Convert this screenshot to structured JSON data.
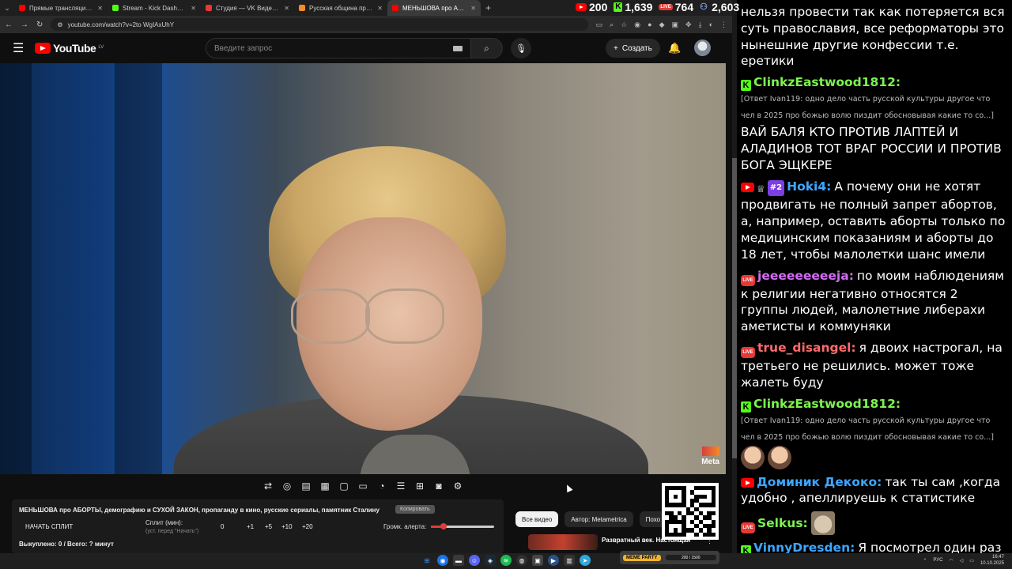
{
  "browser": {
    "tabs": [
      {
        "title": "Прямые трансляции - YouTube",
        "color": "#ff0000",
        "active": false
      },
      {
        "title": "Stream - Kick Dashboard",
        "color": "#53fc18",
        "active": false
      },
      {
        "title": "Студия — VK Видео Live",
        "color": "#e53935",
        "active": false
      },
      {
        "title": "Русская община про мигрант...",
        "color": "#f28c28",
        "active": false
      },
      {
        "title": "МЕНЬШОВА про АБОРТЫ...",
        "color": "#ff0000",
        "active": true
      }
    ],
    "url": "youtube.com/watch?v=2to WgIAxUhY"
  },
  "counters": {
    "youtube": "200",
    "kick": "1,639",
    "vk": "764",
    "total": "2,603"
  },
  "youtube": {
    "logo_text": "YouTube",
    "logo_region": "LV",
    "search_placeholder": "Введите запрос",
    "create_label": "Создать",
    "video_watermark": "Meta"
  },
  "split_panel": {
    "title": "МЕНЬШОВА про АБОРТЫ, демографию и СУХОЙ ЗАКОН, пропаганду в кино, русские сериалы, памятник Сталину",
    "copy_label": "Копировать",
    "start_label": "НАЧАТЬ СПЛИТ",
    "split_min_label": "Сплит (мин):",
    "split_min_hint": "(уст. перед \"Начать\")",
    "split_value": "0",
    "increments": [
      "+1",
      "+5",
      "+10",
      "+20"
    ],
    "alert_volume_label": "Громк. алерта:",
    "alert_volume": 0.2,
    "bought_label": "Выкуплено: 0 / Всего: ? минут"
  },
  "recommendations": {
    "chips": [
      {
        "label": "Все видео",
        "active": true
      },
      {
        "label": "Автор: Metametrica",
        "active": false
      },
      {
        "label": "Похо",
        "active": false
      }
    ],
    "first_video_title": "Развратный век. Настоящая"
  },
  "chat": {
    "messages": [
      {
        "badges": [],
        "user": "",
        "user_color": "#ffffff",
        "reply": "",
        "text": "нельзя провести так как потеряется вся суть православия, все реформаторы это нынешние другие конфессии т.е. еретики"
      },
      {
        "badges": [
          "kick"
        ],
        "user": "ClinkzEastwood1812:",
        "user_color": "#7cf34f",
        "reply": "[Ответ Ivan119: одно дело часть русской культуры другое что чел в 2025 про божью волю пиздит обосновывая какие то со...]",
        "text": "ВАЙ БАЛЯ КТО ПРОТИВ ЛАПТЕЙ И АЛАДИНОВ ТОТ ВРАГ РОССИИ И ПРОТИВ БОГА ЭЩКЕРЕ"
      },
      {
        "badges": [
          "youtube",
          "crown",
          "rank"
        ],
        "rank": "#2",
        "user": "Hoki4:",
        "user_color": "#3ea6ff",
        "reply": "",
        "text": "А почему они не хотят продвигать не полный запрет абортов, а, например, оставить аборты только по медицинским показаниям и аборты до 18 лет, чтобы малолетки шанс имели"
      },
      {
        "badges": [
          "vk"
        ],
        "user": "jeeeeeeeeeja:",
        "user_color": "#d16cf2",
        "reply": "",
        "text": "по моим наблюдениям к религии негативно относятся 2 группы людей, малолетние либерахи аметисты и коммуняки"
      },
      {
        "badges": [
          "vk"
        ],
        "user": "true_disangel:",
        "user_color": "#ff6b6b",
        "reply": "",
        "text": "я двоих настрогал, на третьего не решились. может тоже жалеть буду"
      },
      {
        "badges": [
          "kick"
        ],
        "user": "ClinkzEastwood1812:",
        "user_color": "#7cf34f",
        "reply": "[Ответ Ivan119: одно дело часть русской культуры другое что чел в 2025 про божью волю пиздит обосновывая какие то со...]",
        "text": "",
        "emotes": [
          "face",
          "face"
        ]
      },
      {
        "badges": [
          "youtube"
        ],
        "user": "Доминик Декоко:",
        "user_color": "#3ea6ff",
        "reply": "",
        "text": "так ты сам ,когда удобно , апеллируешь к статистике"
      },
      {
        "badges": [
          "vk"
        ],
        "user": "Selkus:",
        "user_color": "#7cf34f",
        "reply": "",
        "text": "",
        "emotes": [
          "cat"
        ]
      },
      {
        "badges": [
          "kick"
        ],
        "user": "VinnyDresden:",
        "user_color": "#3ea6ff",
        "reply": "",
        "text": "Я посмотрел один раз на процедуру аборта и больше не хочу."
      }
    ]
  },
  "taskbar": {
    "party_label": "MEME PARTY",
    "party_progress": "200 / 1500",
    "lang": "РУС",
    "time": "16:47",
    "date": "10.10.2025"
  }
}
